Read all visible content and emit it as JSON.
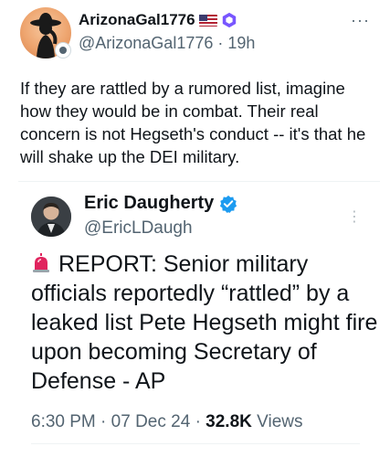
{
  "tweet": {
    "display_name": "ArizonaGal1776",
    "handle": "@ArizonaGal1776",
    "time": "19h",
    "separator": "·",
    "flag_icon": "us-flag-icon",
    "badge_icon": "purple-hexagon-badge-icon",
    "more_icon": "more-icon",
    "text": "If they are rattled by a rumored list, imagine how they would be in combat. Their real concern is not Hegseth's conduct -- it's that he will shake up the DEI military."
  },
  "quoted": {
    "display_name": "Eric Daugherty",
    "handle": "@EricLDaugh",
    "verified_icon": "blue-check-icon",
    "siren_icon": "siren-emoji-icon",
    "text": "REPORT: Senior military officials reportedly “rattled” by a leaked list Pete Hegseth might fire upon becoming Secretary of Defense - AP",
    "time": "6:30 PM",
    "date": "07 Dec 24",
    "separator": "·",
    "views_count": "32.8K",
    "views_label": "Views"
  },
  "colors": {
    "text": "#0f1419",
    "secondary": "#536471",
    "verified_blue": "#1d9bf0",
    "badge_purple": "#7856ff"
  }
}
